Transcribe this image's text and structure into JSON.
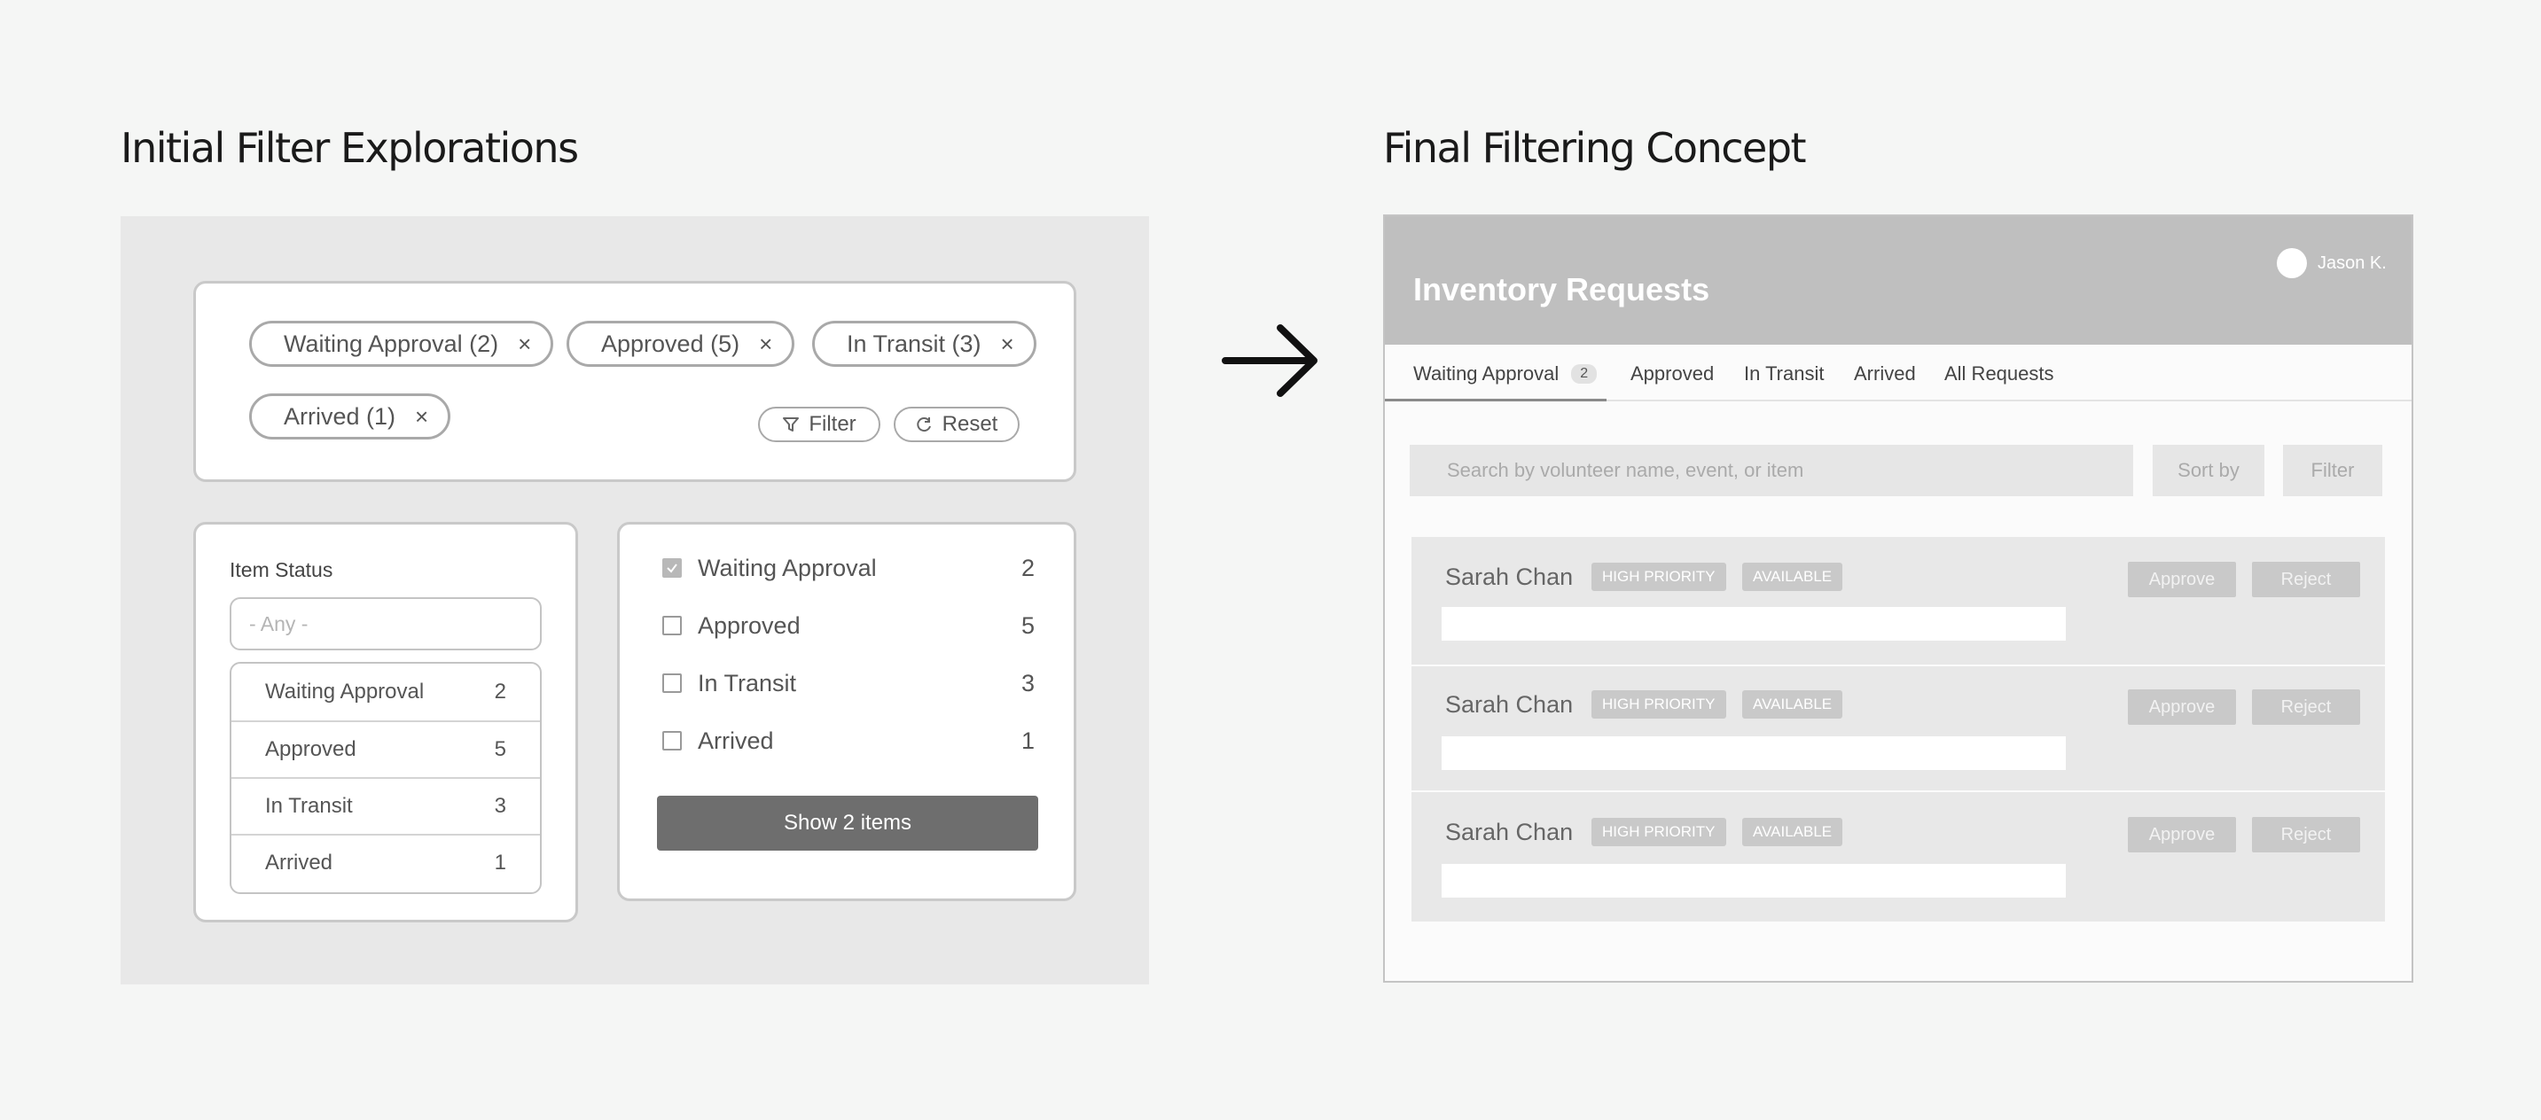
{
  "left": {
    "heading": "Initial Filter Explorations",
    "chips": [
      "Waiting Approval (2)",
      "Approved (5)",
      "In Transit (3)",
      "Arrived (1)"
    ],
    "chip_close": "×",
    "filter_label": "Filter",
    "reset_label": "Reset",
    "dropdown_card": {
      "title": "Item Status",
      "placeholder": "- Any -",
      "options": [
        {
          "label": "Waiting Approval",
          "count": "2"
        },
        {
          "label": "Approved",
          "count": "5"
        },
        {
          "label": "In Transit",
          "count": "3"
        },
        {
          "label": "Arrived",
          "count": "1"
        }
      ]
    },
    "checkbox_card": {
      "options": [
        {
          "label": "Waiting Approval",
          "count": "2",
          "checked": true
        },
        {
          "label": "Approved",
          "count": "5",
          "checked": false
        },
        {
          "label": "In Transit",
          "count": "3",
          "checked": false
        },
        {
          "label": "Arrived",
          "count": "1",
          "checked": false
        }
      ],
      "button": "Show 2 items"
    }
  },
  "right": {
    "heading": "Final Filtering Concept",
    "app_title": "Inventory Requests",
    "user_name": "Jason K.",
    "tabs": [
      {
        "label": "Waiting Approval",
        "badge": "2",
        "active": true
      },
      {
        "label": "Approved"
      },
      {
        "label": "In Transit"
      },
      {
        "label": "Arrived"
      },
      {
        "label": "All Requests"
      }
    ],
    "search_placeholder": "Search by volunteer name, event, or item",
    "sort_label": "Sort by",
    "filter_label": "Filter",
    "requests": [
      {
        "name": "Sarah Chan",
        "tags": [
          "HIGH PRIORITY",
          "AVAILABLE"
        ],
        "approve": "Approve",
        "reject": "Reject"
      },
      {
        "name": "Sarah Chan",
        "tags": [
          "HIGH PRIORITY",
          "AVAILABLE"
        ],
        "approve": "Approve",
        "reject": "Reject"
      },
      {
        "name": "Sarah Chan",
        "tags": [
          "HIGH PRIORITY",
          "AVAILABLE"
        ],
        "approve": "Approve",
        "reject": "Reject"
      }
    ]
  },
  "colors": {
    "page_bg": "#f5f6f5",
    "panel_bg": "#e8e8e8",
    "header_gray": "#bfbfbf",
    "tag_gray": "#c9c9c9",
    "button_dark": "#6e6e6e"
  }
}
